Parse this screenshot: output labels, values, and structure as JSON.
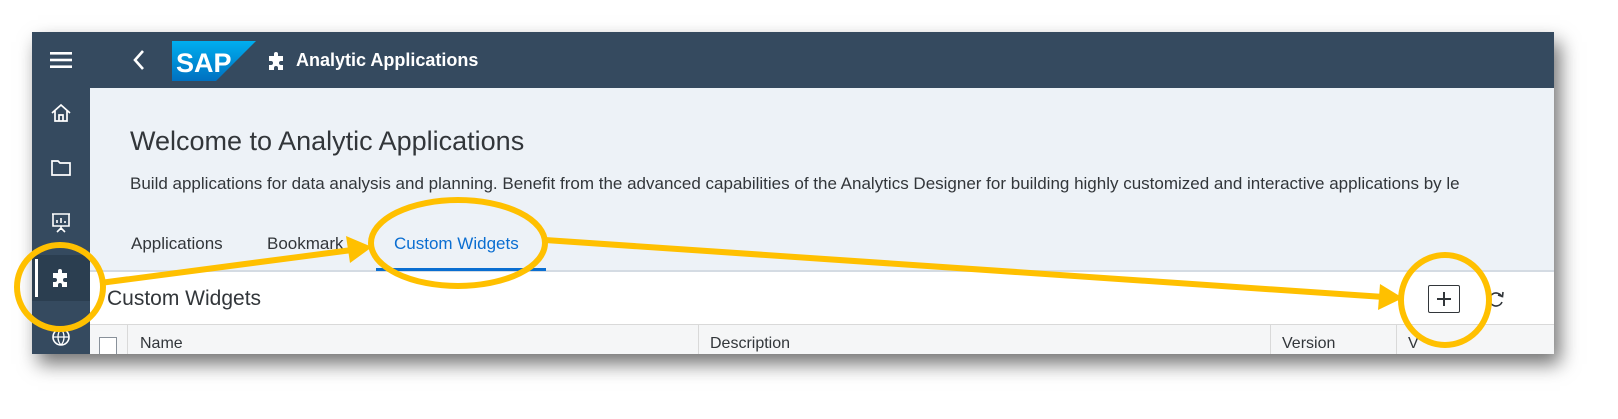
{
  "shell": {
    "title": "Analytic Applications",
    "logo_text": "SAP",
    "brand_color": "#354a5f"
  },
  "nav": {
    "items": [
      {
        "name": "home",
        "icon": "home-icon"
      },
      {
        "name": "files",
        "icon": "folder-icon"
      },
      {
        "name": "stories",
        "icon": "presentation-icon"
      },
      {
        "name": "analytic-applications",
        "icon": "puzzle-icon",
        "active": true
      },
      {
        "name": "more",
        "icon": "globe-icon"
      }
    ]
  },
  "page": {
    "title": "Welcome to Analytic Applications",
    "subtitle": "Build applications for data analysis and planning. Benefit from the advanced capabilities of the Analytics Designer for building highly customized and interactive applications by le"
  },
  "tabs": [
    {
      "label": "Applications"
    },
    {
      "label": "Bookmark"
    },
    {
      "label": "Custom Widgets",
      "selected": true
    }
  ],
  "section": {
    "title": "Custom Widgets"
  },
  "table": {
    "columns": [
      "Name",
      "Description",
      "Version",
      "V"
    ]
  },
  "colors": {
    "accent": "#0a6ed1",
    "annotation": "#ffc000"
  }
}
